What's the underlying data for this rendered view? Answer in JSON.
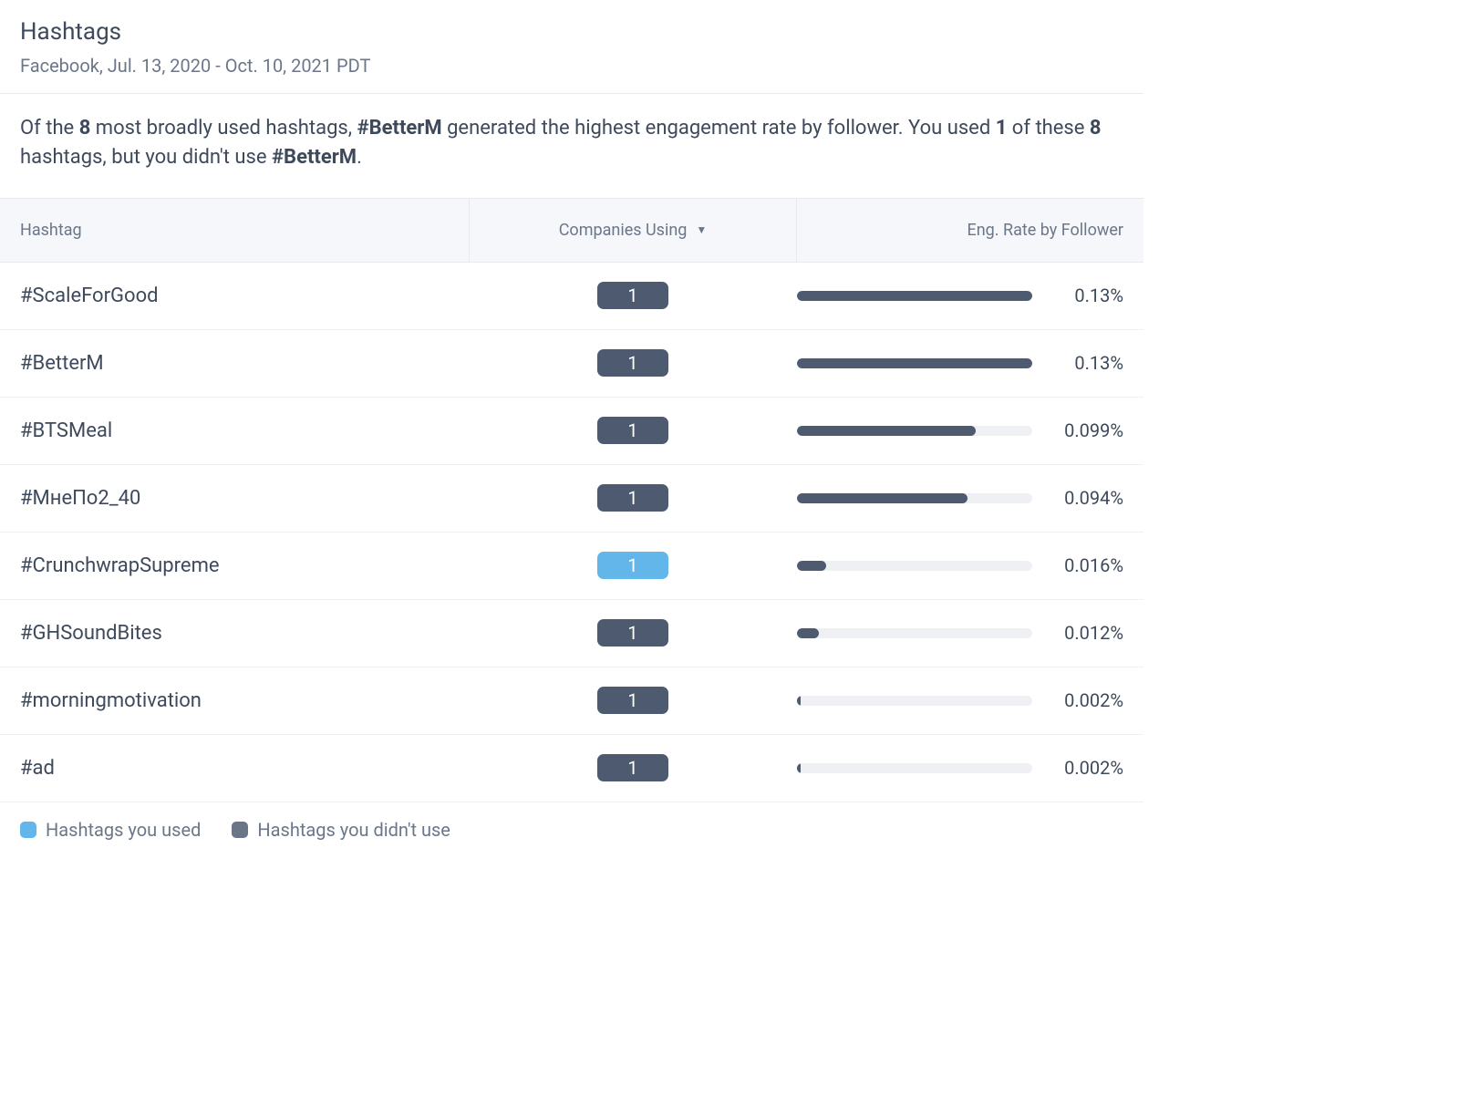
{
  "header": {
    "title": "Hashtags",
    "subtitle": "Facebook, Jul. 13, 2020 - Oct. 10, 2021 PDT"
  },
  "summary": {
    "prefix": "Of the ",
    "count_total": "8",
    "mid1": " most broadly used hashtags, ",
    "top_tag": "#BetterM",
    "mid2": " generated the highest engagement rate by follower. You used ",
    "count_used": "1",
    "mid3": " of these ",
    "count_total2": "8",
    "mid4": " hashtags, but you didn't use ",
    "top_tag2": "#BetterM",
    "suffix": "."
  },
  "columns": {
    "hashtag": "Hashtag",
    "companies": "Companies Using",
    "eng": "Eng. Rate by Follower"
  },
  "legend": {
    "used": "Hashtags you used",
    "not_used": "Hashtags you didn't use"
  },
  "colors": {
    "dark_pill": "#4d5a70",
    "light_pill": "#62b6ea",
    "track": "#eef0f4"
  },
  "chart_data": {
    "type": "bar",
    "title": "Eng. Rate by Follower",
    "xlabel": "",
    "ylabel": "Eng. Rate by Follower",
    "ylim": [
      0,
      0.13
    ],
    "categories": [
      "#ScaleForGood",
      "#BetterM",
      "#BTSMeal",
      "#МнеПо2_40",
      "#CrunchwrapSupreme",
      "#GHSoundBites",
      "#morningmotivation",
      "#ad"
    ],
    "series": [
      {
        "name": "Eng. Rate by Follower (%)",
        "values": [
          0.13,
          0.13,
          0.099,
          0.094,
          0.016,
          0.012,
          0.002,
          0.002
        ]
      },
      {
        "name": "Companies Using",
        "values": [
          1,
          1,
          1,
          1,
          1,
          1,
          1,
          1
        ]
      }
    ],
    "used_flags": [
      false,
      false,
      false,
      false,
      true,
      false,
      false,
      false
    ],
    "value_labels": [
      "0.13%",
      "0.13%",
      "0.099%",
      "0.094%",
      "0.016%",
      "0.012%",
      "0.002%",
      "0.002%"
    ]
  }
}
